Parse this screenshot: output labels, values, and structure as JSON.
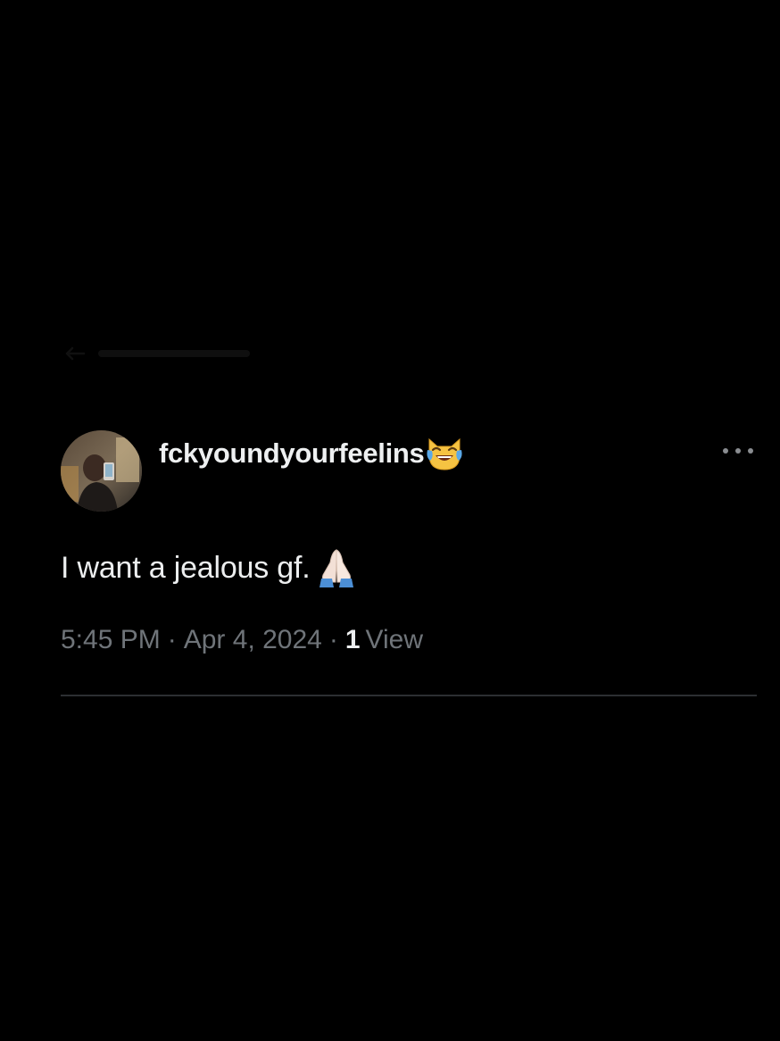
{
  "tweet": {
    "display_name": "fckyoundyourfeelins",
    "name_emoji": "cat-tears-of-joy-emoji",
    "text": "I want a jealous gf.",
    "text_emoji": "folded-hands-emoji",
    "time": "5:45 PM",
    "date": "Apr 4, 2024",
    "separator": "·",
    "views_count": "1",
    "views_label": "View",
    "more_icon": "more-horizontal-icon"
  },
  "colors": {
    "background": "#000000",
    "primary_text": "#eceeef",
    "secondary_text": "#6f7479",
    "divider": "#2c2f32"
  }
}
